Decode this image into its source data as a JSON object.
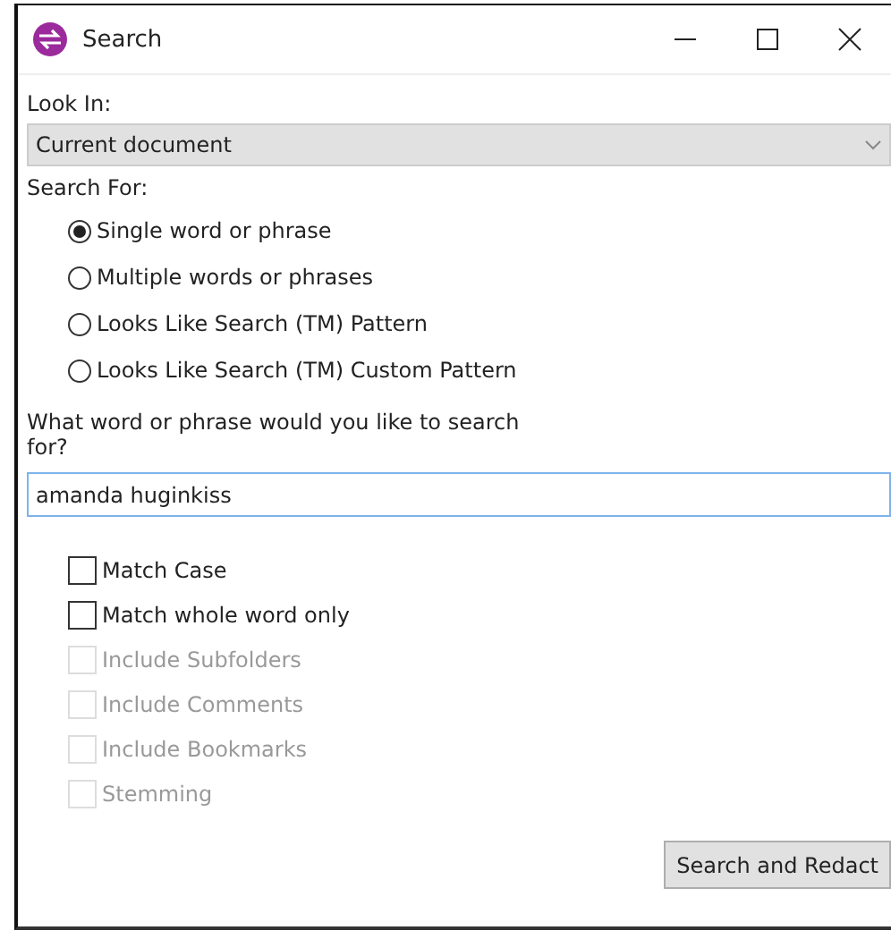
{
  "window": {
    "title": "Search"
  },
  "look_in": {
    "label": "Look In:",
    "value": "Current document"
  },
  "search_for": {
    "label": "Search For:",
    "options": [
      {
        "label": "Single word or phrase",
        "selected": true
      },
      {
        "label": "Multiple words or phrases",
        "selected": false
      },
      {
        "label": "Looks Like Search (TM) Pattern",
        "selected": false
      },
      {
        "label": "Looks Like Search (TM) Custom Pattern",
        "selected": false
      }
    ]
  },
  "query": {
    "label": "What word or phrase would you like to search for?",
    "value": "amanda huginkiss"
  },
  "options": [
    {
      "label": "Match Case",
      "checked": false,
      "disabled": false
    },
    {
      "label": "Match whole word only",
      "checked": false,
      "disabled": false
    },
    {
      "label": "Include Subfolders",
      "checked": false,
      "disabled": true
    },
    {
      "label": "Include Comments",
      "checked": false,
      "disabled": true
    },
    {
      "label": "Include Bookmarks",
      "checked": false,
      "disabled": true
    },
    {
      "label": "Stemming",
      "checked": false,
      "disabled": true
    }
  ],
  "buttons": [
    "Search and Redact"
  ]
}
